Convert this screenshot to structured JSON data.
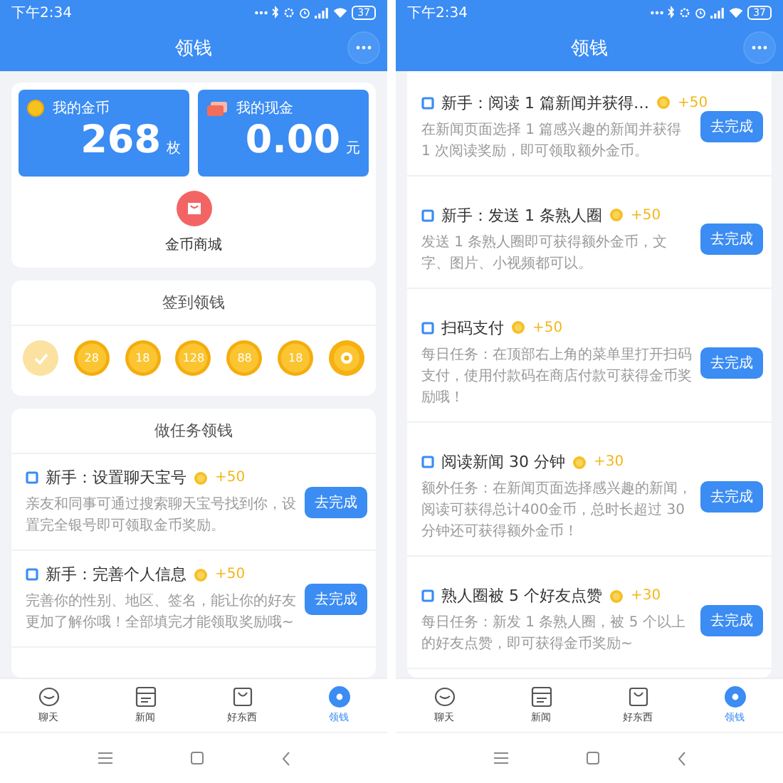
{
  "screens": [
    {
      "status_bar": {
        "time": "下午2:34",
        "battery": "37"
      },
      "header": {
        "title": "领钱"
      },
      "wallet": {
        "tiles": [
          {
            "kind": "coins",
            "label": "我的金币",
            "amount": "268",
            "unit": "枚"
          },
          {
            "kind": "cash",
            "label": "我的现金",
            "amount": "0.00",
            "unit": "元"
          }
        ],
        "mall": {
          "label": "金币商城"
        }
      },
      "checkin": {
        "title": "签到领钱",
        "days": [
          {
            "kind": "done"
          },
          {
            "kind": "amount",
            "label": "28"
          },
          {
            "kind": "amount",
            "label": "18"
          },
          {
            "kind": "amount",
            "label": "128"
          },
          {
            "kind": "amount",
            "label": "88"
          },
          {
            "kind": "amount",
            "label": "18"
          },
          {
            "kind": "bonus"
          }
        ]
      },
      "tasks": {
        "title": "做任务领钱",
        "items": [
          {
            "title": "新手：设置聊天宝号",
            "reward": "+50",
            "button": "去完成",
            "description": "亲友和同事可通过搜索聊天宝号找到你，设置完全银号即可领取金币奖励。"
          },
          {
            "title": "新手：完善个人信息",
            "reward": "+50",
            "button": "去完成",
            "description": "完善你的性别、地区、签名，能让你的好友更加了解你哦！全部填完才能领取奖励哦~"
          }
        ]
      },
      "tabs": [
        {
          "kind": "chat",
          "label": "聊天",
          "selected": false
        },
        {
          "kind": "news",
          "label": "新闻",
          "selected": false
        },
        {
          "kind": "shop",
          "label": "好东西",
          "selected": false
        },
        {
          "kind": "earn",
          "label": "领钱",
          "selected": true
        }
      ]
    },
    {
      "status_bar": {
        "time": "下午2:34",
        "battery": "37"
      },
      "header": {
        "title": "领钱"
      },
      "tasks": {
        "items": [
          {
            "title": "新手：阅读 1 篇新闻并获得…",
            "reward": "+50",
            "button": "去完成",
            "description": "在新闻页面选择 1 篇感兴趣的新闻并获得 1 次阅读奖励，即可领取额外金币。"
          },
          {
            "title": "新手：发送 1 条熟人圈",
            "reward": "+50",
            "button": "去完成",
            "description": "发送 1 条熟人圈即可获得额外金币，文字、图片、小视频都可以。"
          },
          {
            "title": "扫码支付",
            "reward": "+50",
            "button": "去完成",
            "description": "每日任务：在顶部右上角的菜单里打开扫码支付，使用付款码在商店付款可获得金币奖励哦！"
          },
          {
            "title": "阅读新闻 30 分钟",
            "reward": "+30",
            "button": "去完成",
            "description": "额外任务：在新闻页面选择感兴趣的新闻，阅读可获得总计400金币，总时长超过 30 分钟还可获得额外金币！"
          },
          {
            "title": "熟人圈被 5 个好友点赞",
            "reward": "+30",
            "button": "去完成",
            "description": "每日任务：新发 1 条熟人圈，被 5 个以上的好友点赞，即可获得金币奖励~"
          }
        ]
      },
      "tabs": [
        {
          "kind": "chat",
          "label": "聊天",
          "selected": false
        },
        {
          "kind": "news",
          "label": "新闻",
          "selected": false
        },
        {
          "kind": "shop",
          "label": "好东西",
          "selected": false
        },
        {
          "kind": "earn",
          "label": "领钱",
          "selected": true
        }
      ]
    }
  ]
}
